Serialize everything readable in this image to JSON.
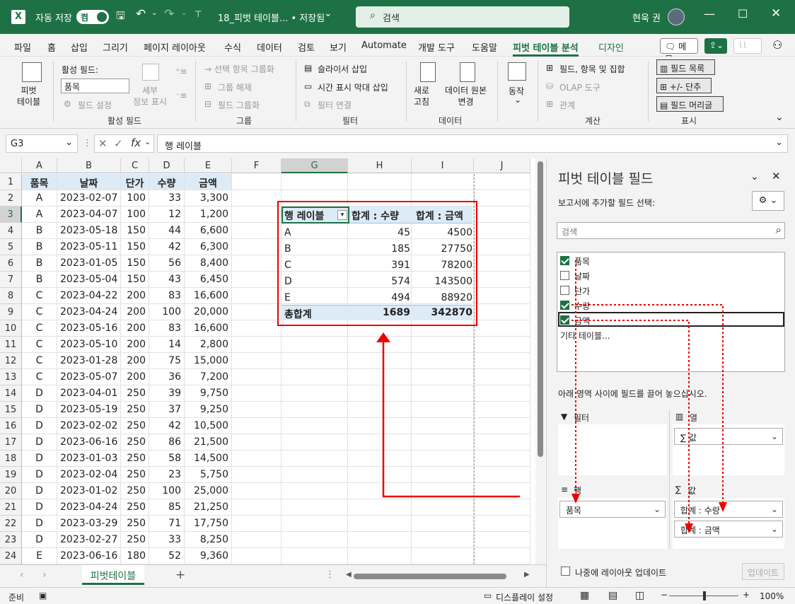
{
  "titlebar": {
    "autosave_label": "자동 저장",
    "autosave_state": "켬",
    "filename": "18_피벗 테이블... • 저장됨",
    "search_placeholder": "검색",
    "user_name": "현욱 권"
  },
  "menu": {
    "tabs": [
      "파일",
      "홈",
      "삽입",
      "그리기",
      "페이지 레이아웃",
      "수식",
      "데이터",
      "검토",
      "보기",
      "Automate",
      "개발 도구",
      "도움말",
      "피벗 테이블 분석",
      "디자인"
    ],
    "memo_label": "메모"
  },
  "ribbon": {
    "pivot_table_label": "피벗\n테이블",
    "active_field_label": "활성 필드:",
    "active_field_value": "품목",
    "field_settings": "필드 설정",
    "drill_down": "세부\n정보 표시",
    "group_active_field": "활성 필드",
    "group_selection": "→ 선택 항목 그룹화",
    "ungroup": "그룹 해제",
    "group_field": "필드 그룹화",
    "group_group": "그룹",
    "insert_slicer": "슬라이서 삽입",
    "insert_timeline": "시간 표시 막대 삽입",
    "filter_connections": "필터 연결",
    "group_filter": "필터",
    "refresh": "새로\n고침",
    "change_source": "데이터 원본\n변경",
    "group_data": "데이터",
    "actions": "동작",
    "fields_items_sets": "필드, 항목 및 집합",
    "olap_tools": "OLAP 도구",
    "relationships": "관계",
    "group_calc": "계산",
    "field_list": "필드 목록",
    "buttons": "+/- 단추",
    "field_headers": "필드 머리글",
    "group_show": "표시"
  },
  "formula": {
    "name_box": "G3",
    "content": "행 레이블"
  },
  "columns": [
    "A",
    "B",
    "C",
    "D",
    "E",
    "F",
    "G",
    "H",
    "I",
    "J"
  ],
  "table": {
    "headers": [
      "품목",
      "날짜",
      "단가",
      "수량",
      "금액"
    ],
    "rows": [
      [
        "A",
        "2023-02-07",
        "100",
        "33",
        "3,300"
      ],
      [
        "A",
        "2023-04-07",
        "100",
        "12",
        "1,200"
      ],
      [
        "B",
        "2023-05-18",
        "150",
        "44",
        "6,600"
      ],
      [
        "B",
        "2023-05-11",
        "150",
        "42",
        "6,300"
      ],
      [
        "B",
        "2023-01-05",
        "150",
        "56",
        "8,400"
      ],
      [
        "B",
        "2023-05-04",
        "150",
        "43",
        "6,450"
      ],
      [
        "C",
        "2023-04-22",
        "200",
        "83",
        "16,600"
      ],
      [
        "C",
        "2023-04-24",
        "200",
        "100",
        "20,000"
      ],
      [
        "C",
        "2023-05-16",
        "200",
        "83",
        "16,600"
      ],
      [
        "C",
        "2023-05-10",
        "200",
        "14",
        "2,800"
      ],
      [
        "C",
        "2023-01-28",
        "200",
        "75",
        "15,000"
      ],
      [
        "C",
        "2023-05-07",
        "200",
        "36",
        "7,200"
      ],
      [
        "D",
        "2023-04-01",
        "250",
        "39",
        "9,750"
      ],
      [
        "D",
        "2023-05-19",
        "250",
        "37",
        "9,250"
      ],
      [
        "D",
        "2023-02-02",
        "250",
        "42",
        "10,500"
      ],
      [
        "D",
        "2023-06-16",
        "250",
        "86",
        "21,500"
      ],
      [
        "D",
        "2023-01-03",
        "250",
        "58",
        "14,500"
      ],
      [
        "D",
        "2023-02-04",
        "250",
        "23",
        "5,750"
      ],
      [
        "D",
        "2023-01-02",
        "250",
        "100",
        "25,000"
      ],
      [
        "D",
        "2023-04-24",
        "250",
        "85",
        "21,250"
      ],
      [
        "D",
        "2023-03-29",
        "250",
        "71",
        "17,750"
      ],
      [
        "D",
        "2023-02-27",
        "250",
        "33",
        "8,250"
      ],
      [
        "E",
        "2023-06-16",
        "180",
        "52",
        "9,360"
      ]
    ]
  },
  "pivot": {
    "row_label": "행 레이블",
    "sum_qty": "합계 : 수량",
    "sum_amount": "합계 : 금액",
    "rows": [
      [
        "A",
        "45",
        "4500"
      ],
      [
        "B",
        "185",
        "27750"
      ],
      [
        "C",
        "391",
        "78200"
      ],
      [
        "D",
        "574",
        "143500"
      ],
      [
        "E",
        "494",
        "88920"
      ]
    ],
    "total_label": "총합계",
    "total_qty": "1689",
    "total_amount": "342870"
  },
  "sheet": {
    "tab_name": "피벗테이블"
  },
  "status": {
    "ready": "준비",
    "display_settings": "디스플레이 설정",
    "zoom": "100%"
  },
  "panel": {
    "title": "피벗 테이블 필드",
    "choose_fields": "보고서에 추가할 필드 선택:",
    "search_placeholder": "검색",
    "fields": [
      {
        "name": "품목",
        "checked": true
      },
      {
        "name": "날짜",
        "checked": false
      },
      {
        "name": "단가",
        "checked": false
      },
      {
        "name": "수량",
        "checked": true
      },
      {
        "name": "금액",
        "checked": true
      }
    ],
    "more_tables": "기타 테이블...",
    "drag_hint": "아래 영역 사이에 필드를 끌어 놓으십시오.",
    "filter_area": "필터",
    "columns_area": "열",
    "rows_area": "행",
    "values_area": "값",
    "columns_item": "∑ 값",
    "rows_item": "품목",
    "values_items": [
      "합계 : 수량",
      "합계 : 금액"
    ],
    "defer_update": "나중에 레이아웃 업데이트",
    "update_button": "업데이트"
  },
  "colors": {
    "excel_green": "#1e7145",
    "annotation_red": "#e00000",
    "header_blue": "#ddebf7"
  }
}
